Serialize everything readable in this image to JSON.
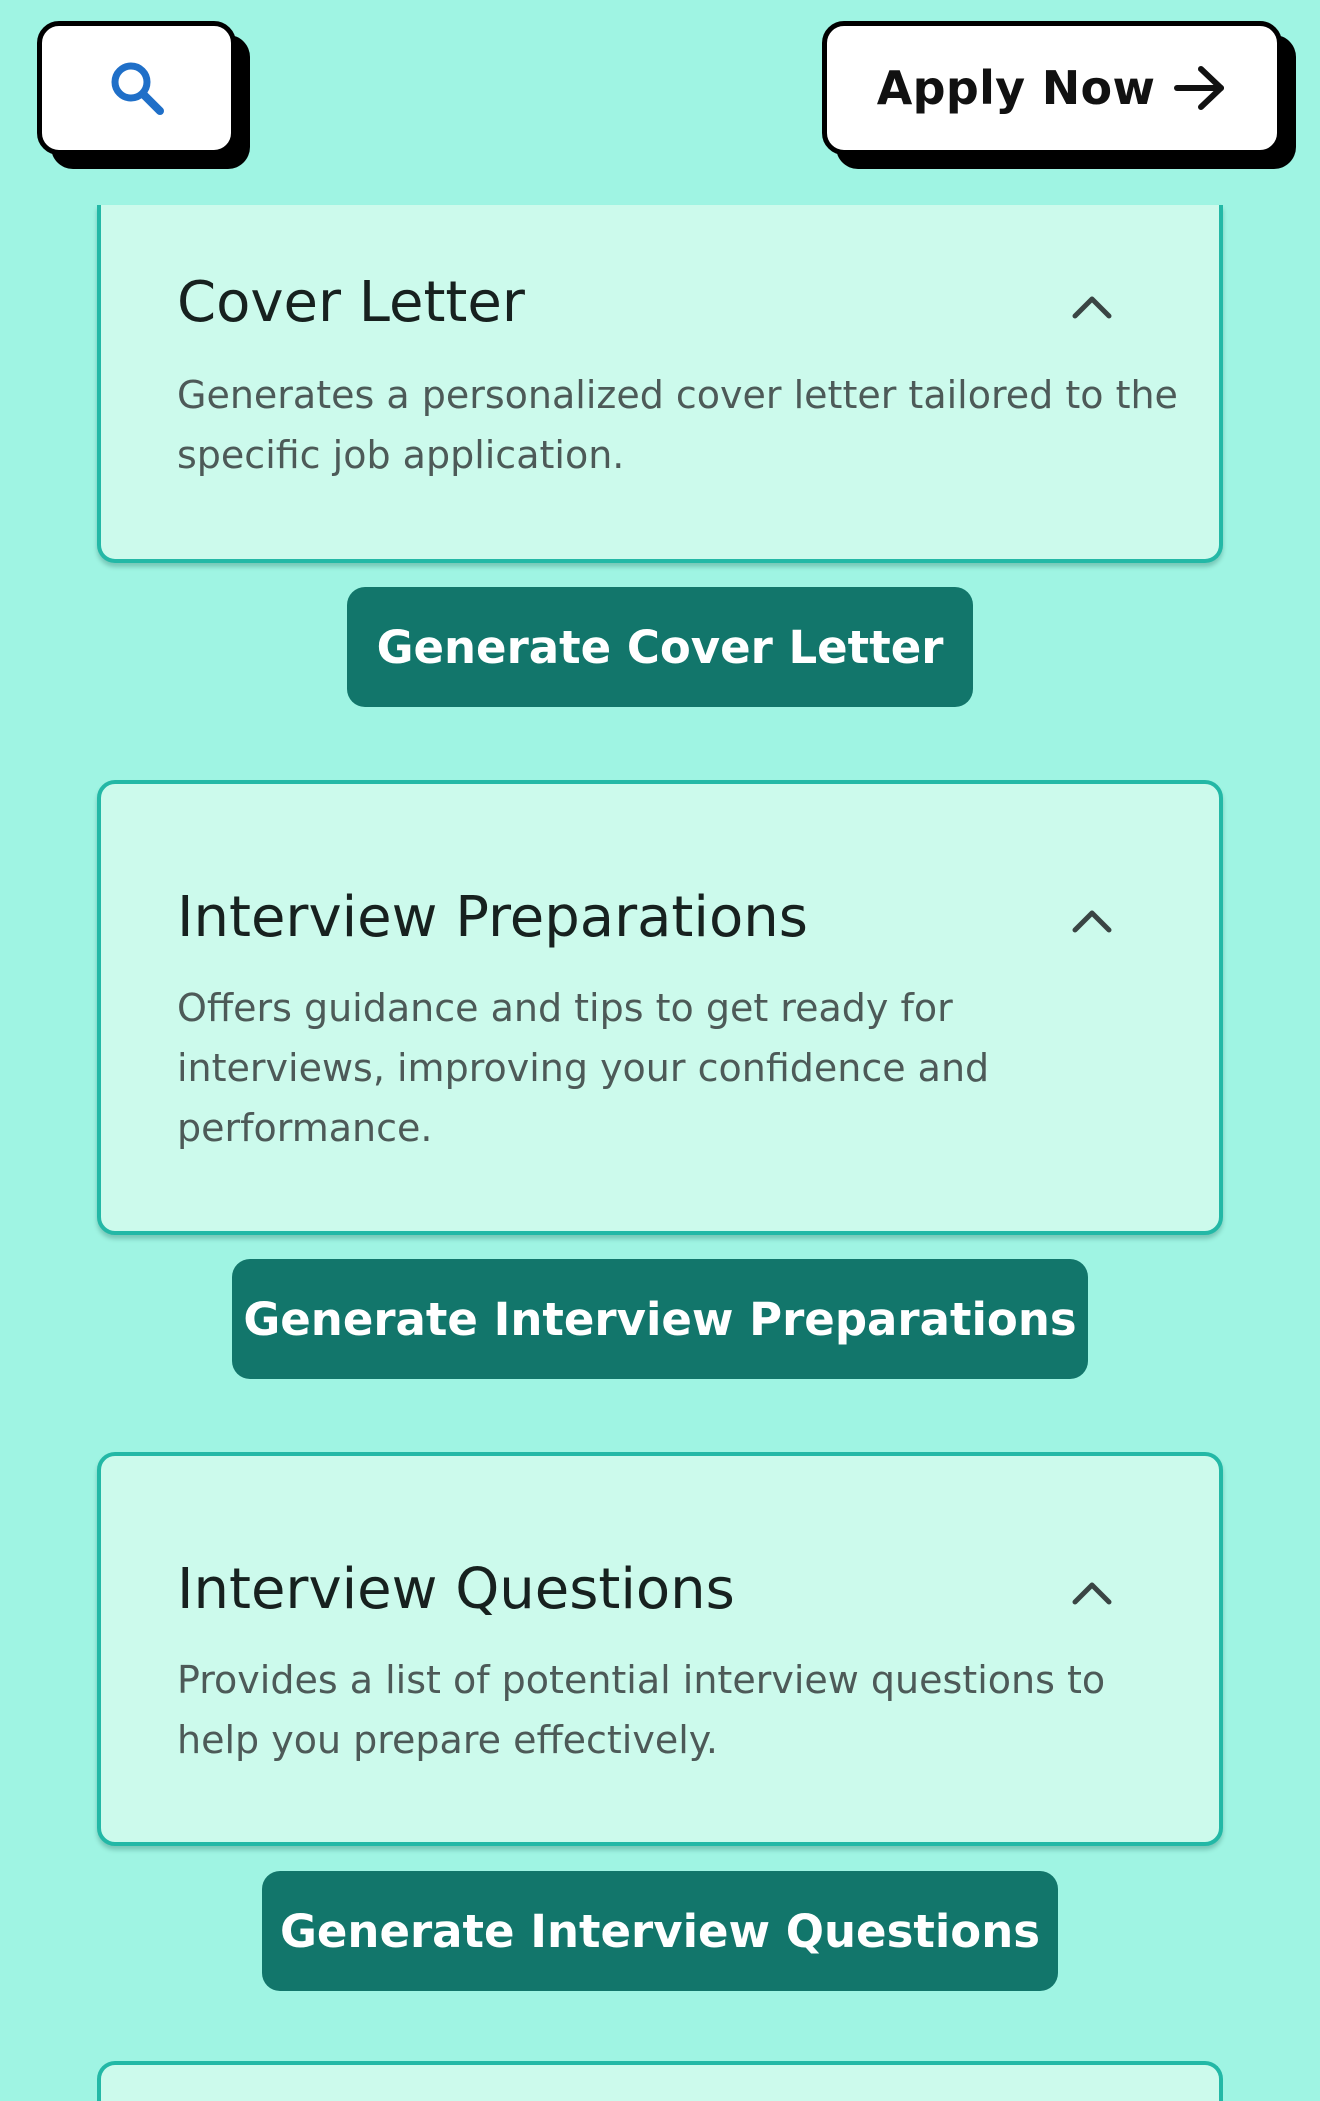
{
  "header": {
    "search_icon": "search-icon",
    "apply_label": "Apply Now",
    "apply_icon": "arrow-right-icon"
  },
  "sections": [
    {
      "title": "Cover Letter",
      "description": "Generates a personalized cover letter tailored to the specific job application.",
      "button_label": "Generate Cover Letter",
      "toggle_icon": "chevron-up-icon"
    },
    {
      "title": "Interview Preparations",
      "description": "Offers guidance and tips to get ready for interviews, improving your confidence and performance.",
      "button_label": "Generate Interview Preparations",
      "toggle_icon": "chevron-up-icon"
    },
    {
      "title": "Interview Questions",
      "description": "Provides a list of potential interview questions to help you prepare effectively.",
      "button_label": "Generate Interview Questions",
      "toggle_icon": "chevron-up-icon"
    }
  ],
  "colors": {
    "background": "#9ff4e3",
    "card_background": "#ccfaec",
    "card_border": "#23b8a6",
    "primary_button": "#12766b",
    "search_icon": "#1f6fc8"
  }
}
